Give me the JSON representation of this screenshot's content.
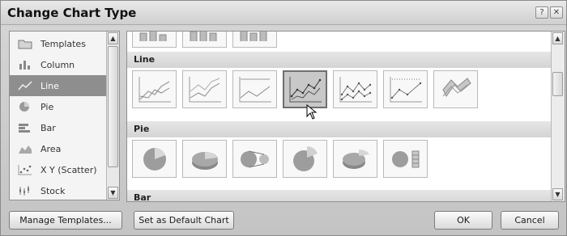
{
  "window": {
    "title": "Change Chart Type",
    "help_glyph": "?",
    "close_glyph": "✕"
  },
  "sidebar": {
    "items": [
      {
        "label": "Templates",
        "icon": "folder-icon",
        "selected": false
      },
      {
        "label": "Column",
        "icon": "column-chart-icon",
        "selected": false
      },
      {
        "label": "Line",
        "icon": "line-chart-icon",
        "selected": true
      },
      {
        "label": "Pie",
        "icon": "pie-chart-icon",
        "selected": false
      },
      {
        "label": "Bar",
        "icon": "bar-chart-icon",
        "selected": false
      },
      {
        "label": "Area",
        "icon": "area-chart-icon",
        "selected": false
      },
      {
        "label": "X Y (Scatter)",
        "icon": "scatter-chart-icon",
        "selected": false
      },
      {
        "label": "Stock",
        "icon": "stock-chart-icon",
        "selected": false
      }
    ]
  },
  "gallery": {
    "sections": [
      {
        "title": "Line",
        "thumbnail_count": 7,
        "selected_index": 3
      },
      {
        "title": "Pie",
        "thumbnail_count": 6
      },
      {
        "title": "Bar"
      }
    ]
  },
  "buttons": {
    "manage_templates": "Manage Templates...",
    "set_default": "Set as Default Chart",
    "ok": "OK",
    "cancel": "Cancel"
  },
  "colors": {
    "selection_gray": "#8e8e8e",
    "dialog_bg": "#c9c9c9"
  }
}
